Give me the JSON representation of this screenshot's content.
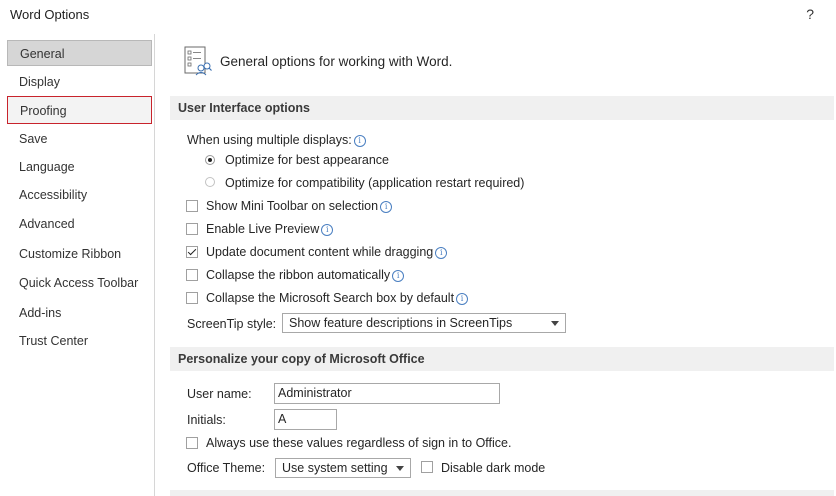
{
  "window": {
    "title": "Word Options",
    "help": "?"
  },
  "sidebar": {
    "items": [
      {
        "label": "General",
        "state": "selected"
      },
      {
        "label": "Display"
      },
      {
        "label": "Proofing",
        "state": "hover"
      },
      {
        "label": "Save"
      },
      {
        "label": "Language"
      },
      {
        "label": "Accessibility"
      },
      {
        "label": "Advanced"
      },
      {
        "label": "Customize Ribbon"
      },
      {
        "label": "Quick Access Toolbar"
      },
      {
        "label": "Add-ins"
      },
      {
        "label": "Trust Center"
      }
    ]
  },
  "header": {
    "text": "General options for working with Word."
  },
  "ui_options": {
    "section_title": "User Interface options",
    "multiple_displays_label": "When using multiple displays:",
    "radio_best": {
      "label": "Optimize for best appearance",
      "checked": true
    },
    "radio_compat": {
      "label": "Optimize for compatibility (application restart required)",
      "checked": false
    },
    "mini_toolbar": {
      "label": "Show Mini Toolbar on selection",
      "checked": false
    },
    "live_preview": {
      "label": "Enable Live Preview",
      "checked": false
    },
    "update_dragging": {
      "label": "Update document content while dragging",
      "checked": true
    },
    "collapse_ribbon": {
      "label": "Collapse the ribbon automatically",
      "checked": false
    },
    "collapse_search": {
      "label": "Collapse the Microsoft Search box by default",
      "checked": false
    },
    "screentip_label": "ScreenTip style:",
    "screentip_value": "Show feature descriptions in ScreenTips"
  },
  "personalize": {
    "section_title": "Personalize your copy of Microsoft Office",
    "username_label": "User name:",
    "username_value": "Administrator",
    "initials_label": "Initials:",
    "initials_value": "A",
    "always_use": {
      "label": "Always use these values regardless of sign in to Office.",
      "checked": false
    },
    "theme_label": "Office Theme:",
    "theme_value": "Use system setting",
    "dark_mode": {
      "label": "Disable dark mode",
      "checked": false
    }
  },
  "colors": {
    "accent_info": "#4a7fc1",
    "hover_border": "#c8232c",
    "section_bg": "#f0f0f0"
  },
  "icons": {
    "header": "options-list-icon",
    "info": "info-icon"
  }
}
